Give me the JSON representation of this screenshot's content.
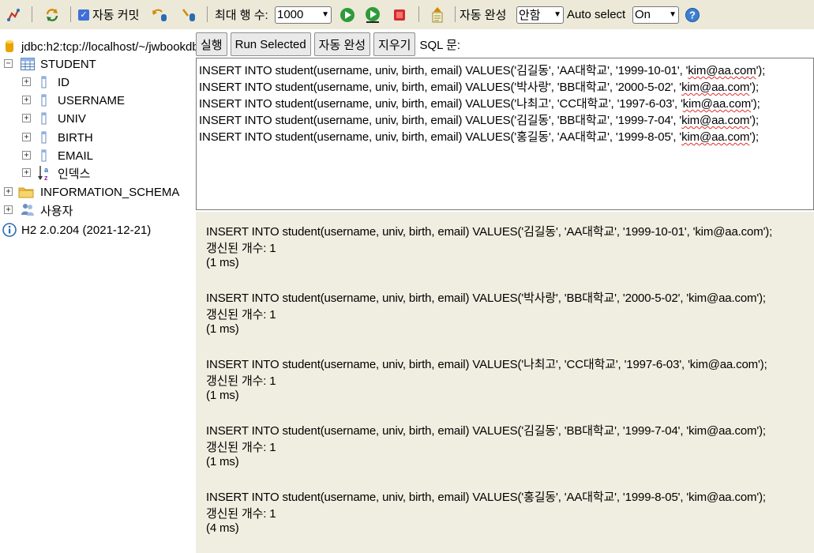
{
  "toolbar": {
    "auto_commit_label": "자동 커밋",
    "max_rows_label": "최대 행 수:",
    "max_rows_value": "1000",
    "auto_complete_label": "자동 완성",
    "auto_complete_value": "안함",
    "auto_select_label": "Auto select",
    "auto_select_value": "On"
  },
  "tree": {
    "connection": "jdbc:h2:tcp://localhost/~/jwbookdb",
    "table": "STUDENT",
    "columns": [
      "ID",
      "USERNAME",
      "UNIV",
      "BIRTH",
      "EMAIL"
    ],
    "indexes": "인덱스",
    "schema": "INFORMATION_SCHEMA",
    "users": "사용자",
    "version": "H2 2.0.204 (2021-12-21)"
  },
  "sqlbar": {
    "run": "실행",
    "run_selected": "Run Selected",
    "auto_complete": "자동 완성",
    "clear": "지우기",
    "sql_label": "SQL 문:"
  },
  "editor": {
    "lines": [
      {
        "pre": "INSERT INTO student(username, univ, birth, email) VALUES('김길동', 'AA대학교', '1999-10-01', '",
        "email": "kim@aa.com",
        "post": "');"
      },
      {
        "pre": "INSERT INTO student(username, univ, birth, email) VALUES('박사랑', 'BB대학교', '2000-5-02', '",
        "email": "kim@aa.com",
        "post": "');"
      },
      {
        "pre": "INSERT INTO student(username, univ, birth, email) VALUES('나최고', 'CC대학교', '1997-6-03', '",
        "email": "kim@aa.com",
        "post": "');"
      },
      {
        "pre": "INSERT INTO student(username, univ, birth, email) VALUES('김길동', 'BB대학교', '1999-7-04', '",
        "email": "kim@aa.com",
        "post": "');"
      },
      {
        "pre": "INSERT INTO student(username, univ, birth, email) VALUES('홍길동', 'AA대학교', '1999-8-05', '",
        "email": "kim@aa.com",
        "post": "');"
      }
    ]
  },
  "results": [
    {
      "sql": "INSERT INTO student(username, univ, birth, email) VALUES('김길동', 'AA대학교', '1999-10-01', 'kim@aa.com');",
      "count": "갱신된 개수: 1",
      "time": "(1 ms)"
    },
    {
      "sql": "INSERT INTO student(username, univ, birth, email) VALUES('박사랑', 'BB대학교', '2000-5-02', 'kim@aa.com');",
      "count": "갱신된 개수: 1",
      "time": "(1 ms)"
    },
    {
      "sql": "INSERT INTO student(username, univ, birth, email) VALUES('나최고', 'CC대학교', '1997-6-03', 'kim@aa.com');",
      "count": "갱신된 개수: 1",
      "time": "(1 ms)"
    },
    {
      "sql": "INSERT INTO student(username, univ, birth, email) VALUES('김길동', 'BB대학교', '1999-7-04', 'kim@aa.com');",
      "count": "갱신된 개수: 1",
      "time": "(1 ms)"
    },
    {
      "sql": "INSERT INTO student(username, univ, birth, email) VALUES('홍길동', 'AA대학교', '1999-8-05', 'kim@aa.com');",
      "count": "갱신된 개수: 1",
      "time": "(4 ms)"
    }
  ]
}
